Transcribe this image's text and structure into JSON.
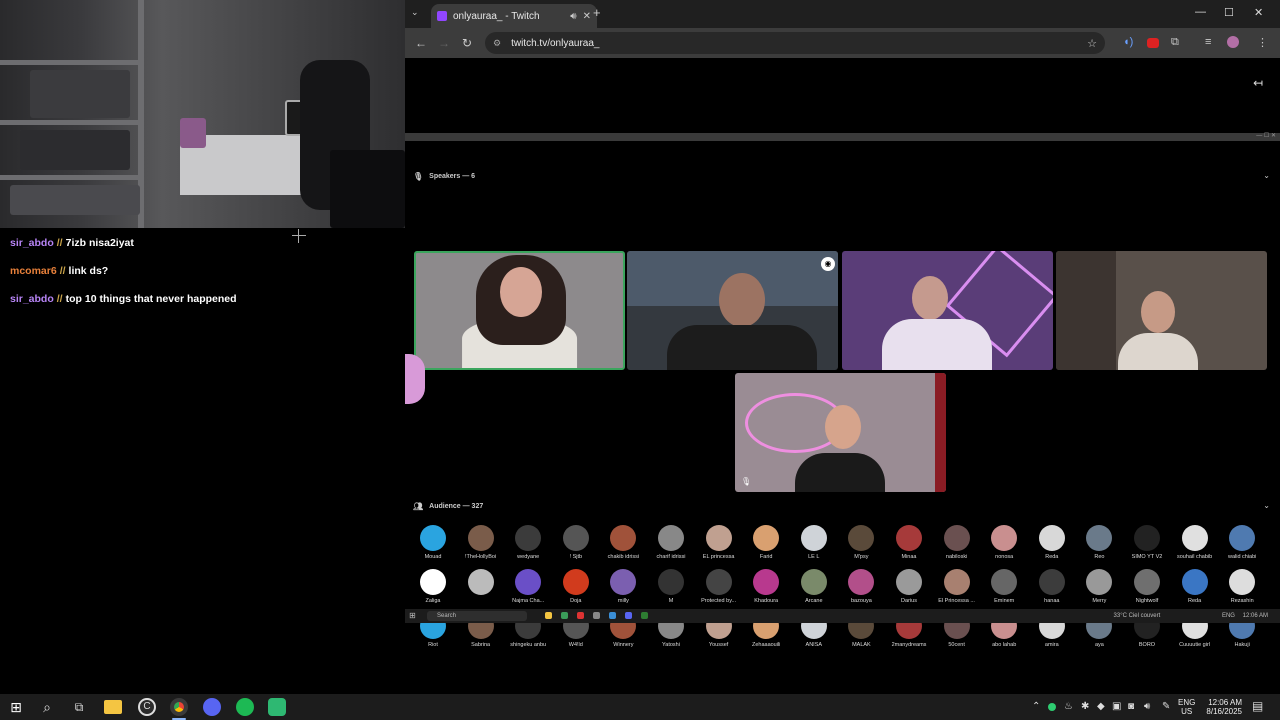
{
  "chat": [
    {
      "user": "sir_abdo",
      "user_color": "#b784f5",
      "message": "7izb nisa2iyat"
    },
    {
      "user": "mcomar6",
      "user_color": "#e8803a",
      "message": "link ds?"
    },
    {
      "user": "sir_abdo",
      "user_color": "#b784f5",
      "message": "top 10 things that never happened"
    }
  ],
  "browser": {
    "tab_title": "onlyauraa_ - Twitch",
    "url": "twitch.tv/onlyauraa_",
    "accent": "#9146ff"
  },
  "discord": {
    "speakers_label": "Speakers — 6",
    "audience_label": "Audience — 327",
    "speaking_border": "#3ba55d",
    "audience": [
      "Mouad",
      "!TheHollyBoi",
      "wedyane",
      "! Sjtb",
      "chakib idrissi",
      "charif idrissi",
      "EL princessa",
      "Farid",
      "LE L",
      "M'psy",
      "Minaa",
      "nabiloski",
      "nonosa",
      "Reda",
      "Reo",
      "SIMO YT V2",
      "souhail chabib",
      "walid chiabi",
      "Zaliga",
      "",
      "Najma Cha...",
      "Doja",
      "milly",
      "M",
      "Protected by...",
      "Khadoura",
      "Arcane",
      "bazouya",
      "Darius",
      "El Princessa ...",
      "Eminem",
      "hanaa",
      "Merry",
      "Nightwolf",
      "Reda",
      "Rezashin",
      "Riot",
      "Sabrina",
      "shingeku anbu",
      "W4!ld",
      "Winnery",
      "Yatoshi",
      "Youssef",
      "Zehaaaouili",
      "ANISA",
      "MALAK",
      "2manydreams",
      "50cent",
      "abo lahab",
      "amira",
      "aya",
      "BORO",
      "Cuuuutie girl",
      "Hakuji"
    ]
  },
  "mini_taskbar": {
    "search_placeholder": "Search",
    "weather": "33°C Ciel couvert",
    "lang": "ENG",
    "time": "12:06 AM"
  },
  "taskbar": {
    "lang_top": "ENG",
    "lang_bottom": "US",
    "time": "12:06 AM",
    "date": "8/16/2025"
  }
}
